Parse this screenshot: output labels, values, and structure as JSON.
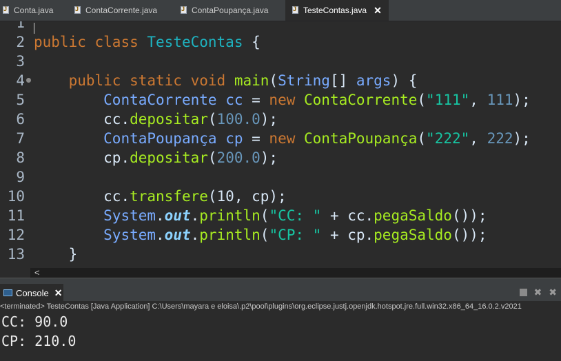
{
  "tabs": [
    {
      "label": "Conta.java"
    },
    {
      "label": "ContaCorrente.java"
    },
    {
      "label": "ContaPoupança.java"
    },
    {
      "label": "TesteContas.java",
      "active": true
    }
  ],
  "editor": {
    "lines": [
      {
        "n": "1",
        "code": []
      },
      {
        "n": "2",
        "code": [
          [
            "kw",
            "public"
          ],
          [
            "p",
            " "
          ],
          [
            "kw",
            "class"
          ],
          [
            "p",
            " "
          ],
          [
            "cls",
            "TesteContas"
          ],
          [
            "p",
            " {"
          ]
        ]
      },
      {
        "n": "3",
        "code": []
      },
      {
        "n": "4",
        "fold": true,
        "code": [
          [
            "p",
            "    "
          ],
          [
            "kw",
            "public"
          ],
          [
            "p",
            " "
          ],
          [
            "kw",
            "static"
          ],
          [
            "p",
            " "
          ],
          [
            "kw",
            "void"
          ],
          [
            "p",
            " "
          ],
          [
            "met",
            "main"
          ],
          [
            "p",
            "("
          ],
          [
            "ty",
            "String"
          ],
          [
            "p",
            "[] "
          ],
          [
            "var",
            "args"
          ],
          [
            "p",
            ") {"
          ]
        ]
      },
      {
        "n": "5",
        "code": [
          [
            "p",
            "        "
          ],
          [
            "ty",
            "ContaCorrente"
          ],
          [
            "p",
            " "
          ],
          [
            "var",
            "cc"
          ],
          [
            "p",
            " = "
          ],
          [
            "kw",
            "new"
          ],
          [
            "p",
            " "
          ],
          [
            "met",
            "ContaCorrente"
          ],
          [
            "p",
            "("
          ],
          [
            "str",
            "\"111\""
          ],
          [
            "p",
            ", "
          ],
          [
            "num",
            "111"
          ],
          [
            "p",
            ");"
          ]
        ]
      },
      {
        "n": "6",
        "code": [
          [
            "p",
            "        "
          ],
          [
            "p",
            "cc."
          ],
          [
            "met",
            "depositar"
          ],
          [
            "p",
            "("
          ],
          [
            "num",
            "100.0"
          ],
          [
            "p",
            ");"
          ]
        ]
      },
      {
        "n": "7",
        "code": [
          [
            "p",
            "        "
          ],
          [
            "ty",
            "ContaPoupança"
          ],
          [
            "p",
            " "
          ],
          [
            "var",
            "cp"
          ],
          [
            "p",
            " = "
          ],
          [
            "kw",
            "new"
          ],
          [
            "p",
            " "
          ],
          [
            "met",
            "ContaPoupança"
          ],
          [
            "p",
            "("
          ],
          [
            "str",
            "\"222\""
          ],
          [
            "p",
            ", "
          ],
          [
            "num",
            "222"
          ],
          [
            "p",
            ");"
          ]
        ]
      },
      {
        "n": "8",
        "code": [
          [
            "p",
            "        "
          ],
          [
            "p",
            "cp."
          ],
          [
            "met",
            "depositar"
          ],
          [
            "p",
            "("
          ],
          [
            "num",
            "200.0"
          ],
          [
            "p",
            ");"
          ]
        ]
      },
      {
        "n": "9",
        "code": []
      },
      {
        "n": "10",
        "code": [
          [
            "p",
            "        "
          ],
          [
            "p",
            "cc."
          ],
          [
            "met",
            "transfere"
          ],
          [
            "p",
            "(10, cp);"
          ]
        ]
      },
      {
        "n": "11",
        "code": [
          [
            "p",
            "        "
          ],
          [
            "ty",
            "System"
          ],
          [
            "p",
            "."
          ],
          [
            "fld",
            "out"
          ],
          [
            "p",
            "."
          ],
          [
            "met",
            "println"
          ],
          [
            "p",
            "("
          ],
          [
            "str",
            "\"CC: \""
          ],
          [
            "p",
            " + cc."
          ],
          [
            "met",
            "pegaSaldo"
          ],
          [
            "p",
            "());"
          ]
        ]
      },
      {
        "n": "12",
        "code": [
          [
            "p",
            "        "
          ],
          [
            "ty",
            "System"
          ],
          [
            "p",
            "."
          ],
          [
            "fld",
            "out"
          ],
          [
            "p",
            "."
          ],
          [
            "met",
            "println"
          ],
          [
            "p",
            "("
          ],
          [
            "str",
            "\"CP: \""
          ],
          [
            "p",
            " + cp."
          ],
          [
            "met",
            "pegaSaldo"
          ],
          [
            "p",
            "());"
          ]
        ]
      },
      {
        "n": "13",
        "code": [
          [
            "p",
            "    }"
          ]
        ]
      }
    ]
  },
  "scroll": {
    "left_arrow": "<"
  },
  "console": {
    "tab_label": "Console",
    "status": "<terminated> TesteContas [Java Application] C:\\Users\\mayara e eloisa\\.p2\\pool\\plugins\\org.eclipse.justj.openjdk.hotspot.jre.full.win32.x86_64_16.0.2.v2021",
    "output": [
      "CC: 90.0",
      "CP: 210.0"
    ]
  },
  "icons": {
    "java_file": "java-file-icon",
    "close": "close-icon",
    "console": "console-icon",
    "stop": "stop-icon",
    "remove": "remove-launch-icon",
    "remove_all": "remove-all-icon"
  }
}
